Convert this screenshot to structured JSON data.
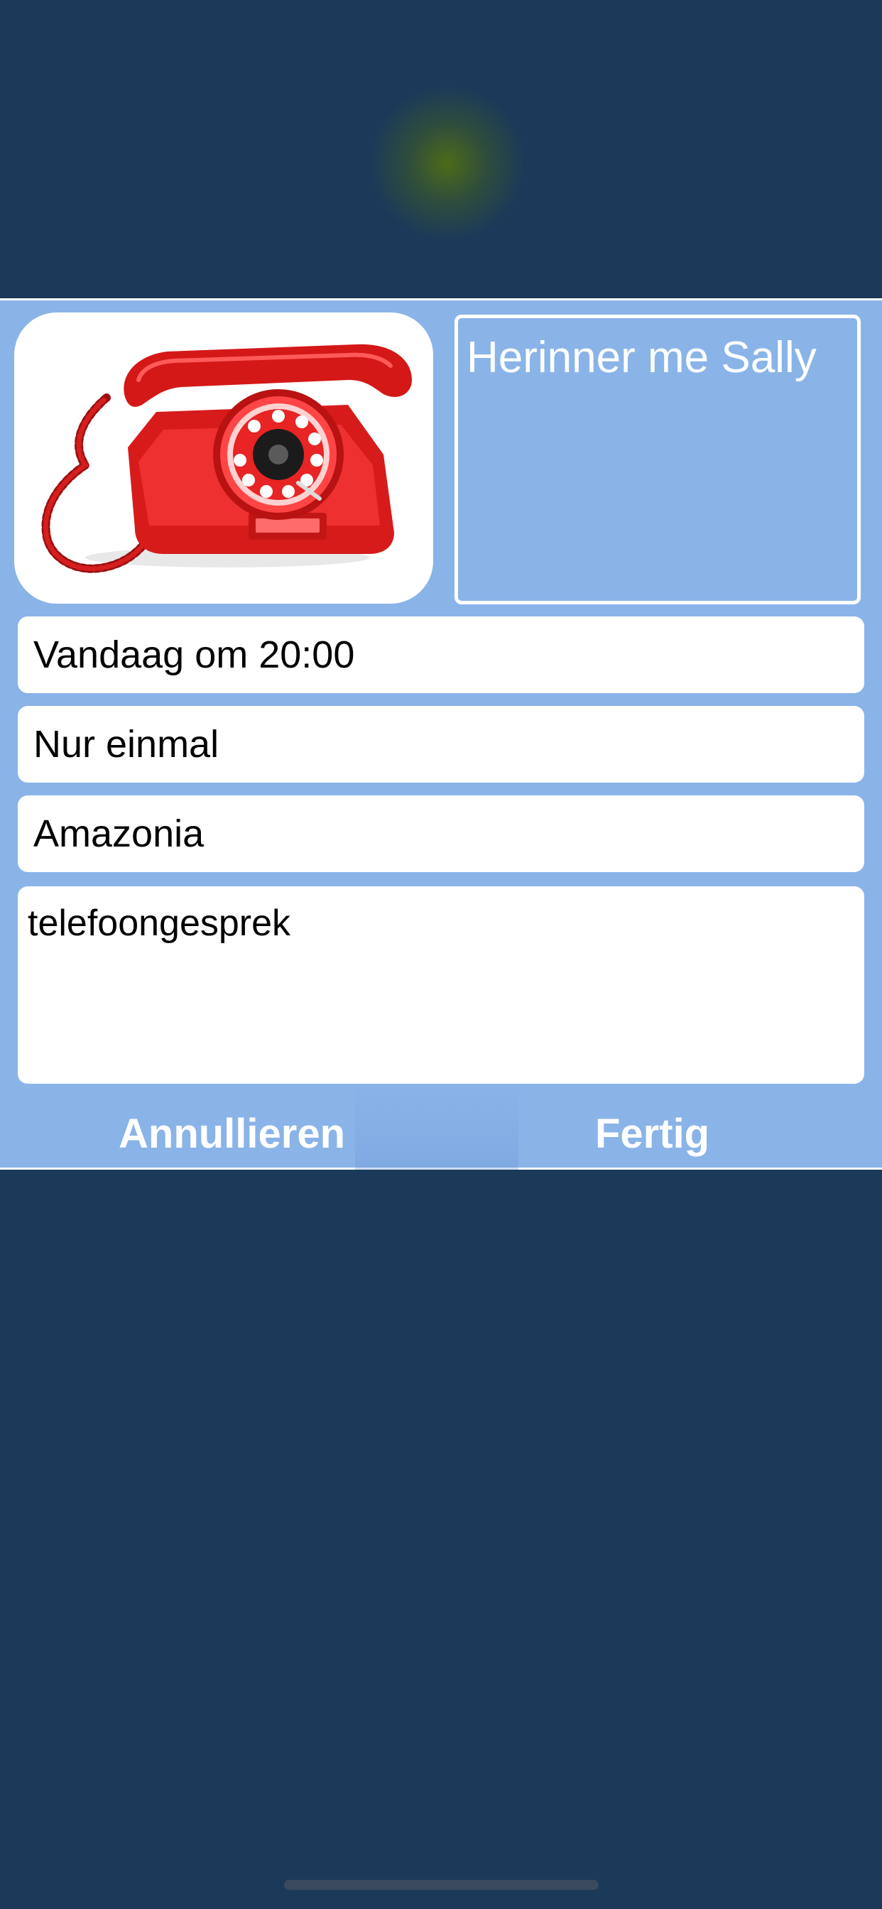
{
  "reminder": {
    "title": "Herinner me Sally",
    "when": "Vandaag om 20:00",
    "repeat": "Nur einmal",
    "sound": "Amazonia",
    "note": "telefoongesprek",
    "image_icon": "red-rotary-telephone-icon"
  },
  "actions": {
    "cancel_label": "Annullieren",
    "done_label": "Fertig"
  },
  "colors": {
    "background": "#1b3a59",
    "panel": "#8ab4e8",
    "field": "#ffffff",
    "phone_red": "#e01818"
  }
}
